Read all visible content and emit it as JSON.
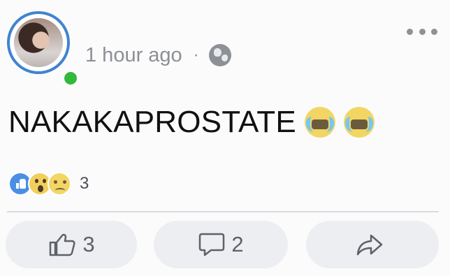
{
  "post": {
    "time": "1 hour ago",
    "separator": "·",
    "privacy_icon": "globe-icon",
    "text": "NAKAKAPROSTATE",
    "emojis": [
      "loudly-crying-face",
      "loudly-crying-face"
    ]
  },
  "reactions": {
    "icons": [
      "like-reaction-icon",
      "wow-reaction-icon",
      "sad-reaction-icon"
    ],
    "count": "3"
  },
  "actions": {
    "like_count": "3",
    "comment_count": "2",
    "share_icon": "share-icon"
  },
  "colors": {
    "avatar_ring": "#3f84d0",
    "online_status": "#33b93a",
    "like_blue": "#4b8ee6"
  }
}
